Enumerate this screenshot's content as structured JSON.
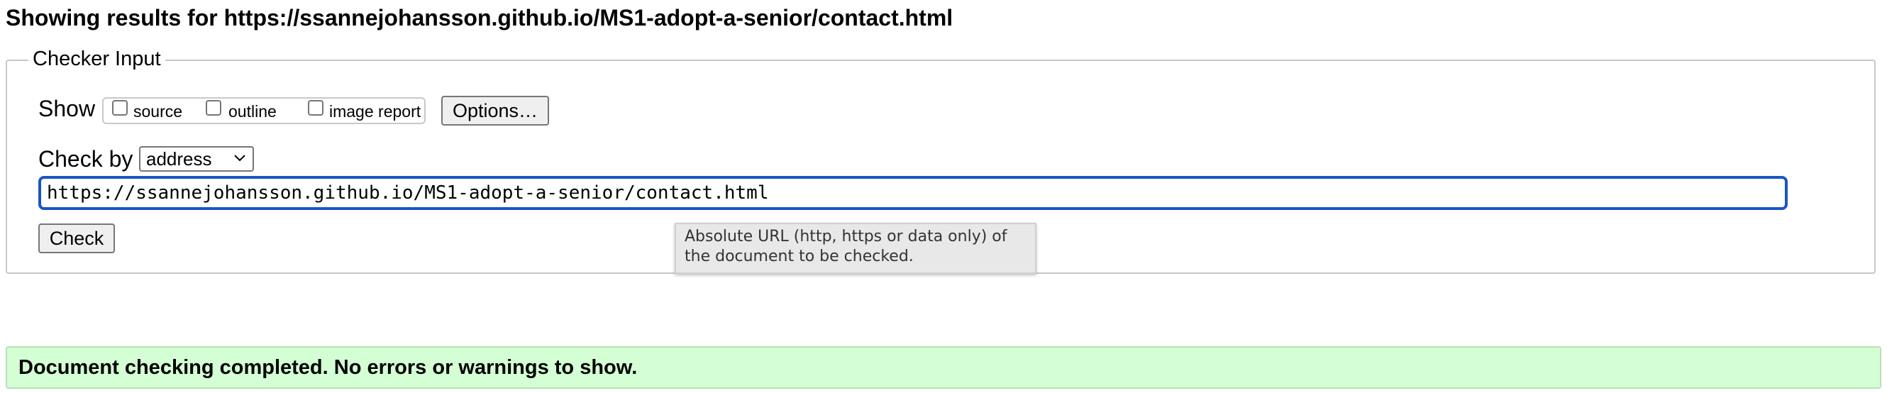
{
  "header": {
    "title": "Showing results for https://ssannejohansson.github.io/MS1-adopt-a-senior/contact.html"
  },
  "checker_input": {
    "legend": "Checker Input",
    "show_label": "Show",
    "show_options": [
      {
        "label": "source",
        "checked": false
      },
      {
        "label": "outline",
        "checked": false
      },
      {
        "label": "image report",
        "checked": false
      }
    ],
    "options_button": "Options…",
    "check_by_label": "Check by",
    "check_by_value": "address",
    "url_value": "https://ssannejohansson.github.io/MS1-adopt-a-senior/contact.html",
    "check_button": "Check",
    "tooltip": "Absolute URL (http, https or data only) of the document to be checked."
  },
  "status": {
    "message": "Document checking completed. No errors or warnings to show."
  },
  "icons": {
    "select_arrow": "chevron-down-icon"
  },
  "colors": {
    "focus_border": "#1a55c7",
    "success_background": "#d4ffd4"
  }
}
